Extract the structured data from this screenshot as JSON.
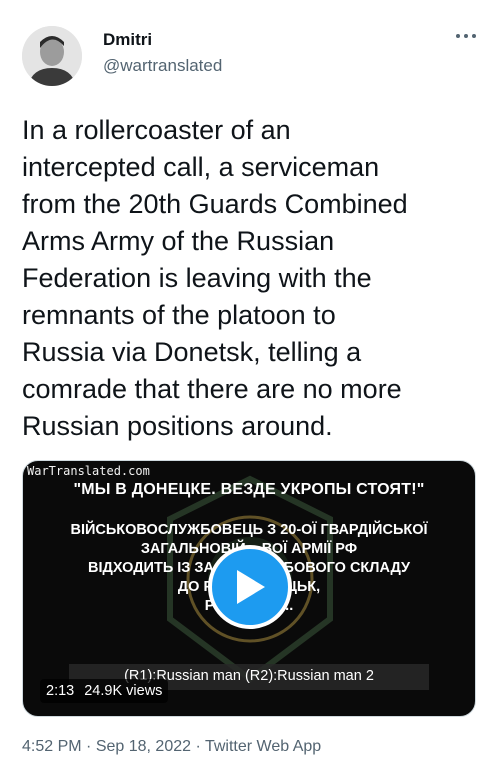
{
  "author": {
    "name": "Dmitri",
    "handle": "@wartranslated"
  },
  "tweet": {
    "text": "In a rollercoaster of an\nintercepted call, a serviceman\nfrom the 20th Guards Combined\nArms Army of the Russian\nFederation is leaving with the\nremnants of the platoon to\nRussia via Donetsk, telling a\ncomrade that there are no more\nRussian positions around."
  },
  "video": {
    "watermark": "WarTranslated.com",
    "headline": "\"МЫ В ДОНЕЦКЕ. ВЕЗДЕ УКРОПЫ СТОЯТ!\"",
    "caption_lines": "ВІЙСЬКОВОСЛУЖБОВЕЦЬ З 20-ОЇ ГВАРДІЙСЬКОЇ\nЗАГАЛЬНОВІЙ... ВОЇ АРМІЇ РФ\nВІДХОДИТЬ ІЗ ЗАЛИ... ОСОБОВОГО СКЛАДУ\nДО РОСІ... ОНЕЦЬК,\nРОЗПОВІД...",
    "subtitle": "(R1):Russian man (R2):Russian man 2",
    "duration": "2:13",
    "views": "24.9K views",
    "accent": "#1d9bf0"
  },
  "meta": {
    "time": "4:52 PM",
    "separator1": " · ",
    "date": "Sep 18, 2022",
    "separator2": " · ",
    "source": "Twitter Web App"
  },
  "icons": {
    "more": "more-icon",
    "play": "play-icon"
  }
}
